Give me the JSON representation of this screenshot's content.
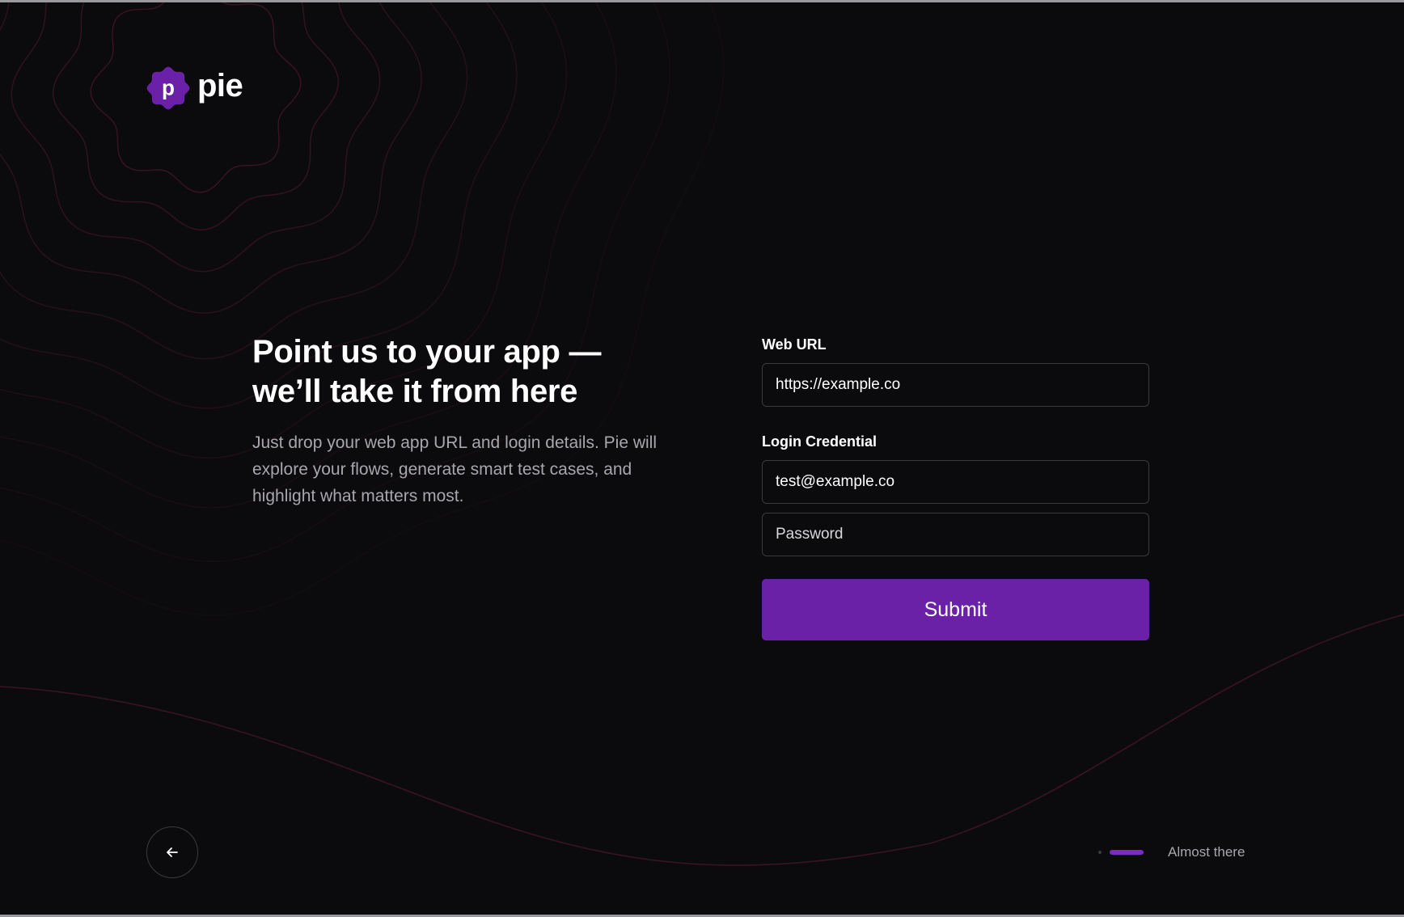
{
  "brand": {
    "name": "pie",
    "mark_letter": "p",
    "accent_color": "#6a21a8"
  },
  "hero": {
    "title_line1": "Point us to your app —",
    "title_line2": "we’ll take it from here",
    "description": "Just drop your web app URL and login details. Pie will explore your flows, generate smart test cases, and highlight what matters most."
  },
  "form": {
    "web_url_label": "Web URL",
    "web_url_value": "https://example.co",
    "login_label": "Login Credential",
    "email_value": "test@example.co",
    "password_placeholder": "Password",
    "submit_label": "Submit"
  },
  "navigation": {
    "back_icon": "arrow-left-icon"
  },
  "progress": {
    "label": "Almost there",
    "fraction": 0.75
  }
}
